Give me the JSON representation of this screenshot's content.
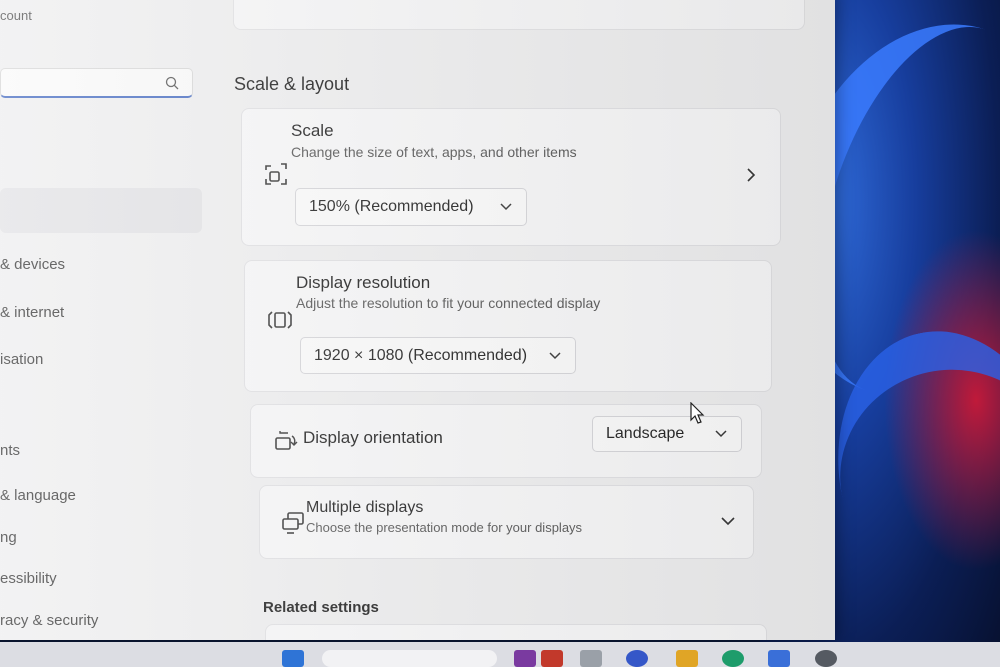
{
  "sidebar": {
    "account_text": "count",
    "search": {
      "value": "",
      "placeholder": ""
    },
    "items": [
      {
        "label": "& devices"
      },
      {
        "label": "& internet"
      },
      {
        "label": "isation"
      },
      {
        "label": "nts"
      },
      {
        "label": "& language"
      },
      {
        "label": "ng"
      },
      {
        "label": "essibility"
      },
      {
        "label": "racy & security"
      }
    ]
  },
  "main": {
    "section_title": "Scale & layout",
    "scale": {
      "title": "Scale",
      "subtitle": "Change the size of text, apps, and other items",
      "value": "150% (Recommended)",
      "icon": "scale-icon"
    },
    "resolution": {
      "title": "Display resolution",
      "subtitle": "Adjust the resolution to fit your connected display",
      "value": "1920 × 1080 (Recommended)",
      "icon": "resolution-icon"
    },
    "orientation": {
      "title": "Display orientation",
      "value": "Landscape",
      "icon": "orientation-icon"
    },
    "multiple": {
      "title": "Multiple displays",
      "subtitle": "Choose the presentation mode for your displays",
      "icon": "multiple-displays-icon"
    },
    "related_title": "Related settings"
  },
  "colors": {
    "accent": "#4a6fc3",
    "window_bg": "#efeff0",
    "card_bg": "#f8f8f9"
  }
}
